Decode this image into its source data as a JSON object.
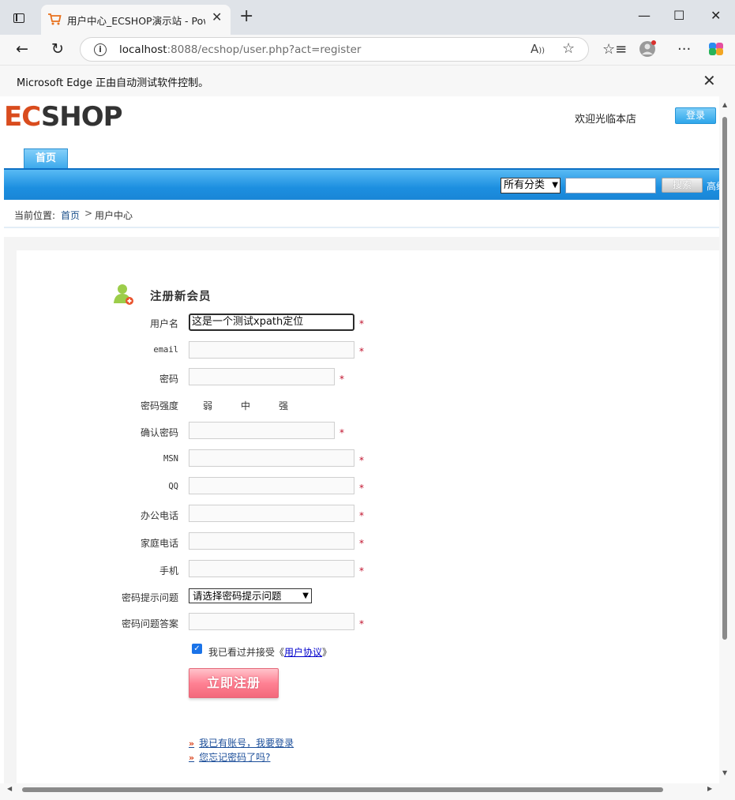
{
  "browser": {
    "tab_title": "用户中心_ECSHOP演示站 - Powered by ECShop",
    "tab_close": "✕",
    "new_tab": "+",
    "window": {
      "minimize": "—",
      "maximize": "☐",
      "close": "✕"
    },
    "url_host": "localhost",
    "url_rest": ":8088/ecshop/user.php?act=register",
    "read_aloud": "Ȃ",
    "infobar_message": "Microsoft Edge 正由自动测试软件控制。",
    "infobar_close": "✕"
  },
  "site": {
    "logo_ec": "EC",
    "logo_shop": "SHOP",
    "welcome": "欢迎光临本店",
    "login_button": "登录",
    "nav_home": "首页",
    "search": {
      "category_selected": "所有分类",
      "keyword": "",
      "button": "搜索",
      "advanced": "高级搜索"
    },
    "breadcrumb": {
      "prefix": "当前位置:",
      "home": "首页",
      "separator": ">",
      "current": "用户中心"
    }
  },
  "register": {
    "title": "注册新会员",
    "fields": {
      "username": {
        "label": "用户名",
        "value": "这是一个测试xpath定位",
        "required": "*"
      },
      "email": {
        "label": "email",
        "value": "",
        "required": "*"
      },
      "password": {
        "label": "密码",
        "value": "",
        "required": "*"
      },
      "strength": {
        "label": "密码强度",
        "weak": "弱",
        "medium": "中",
        "strong": "强"
      },
      "confirm_password": {
        "label": "确认密码",
        "value": "",
        "required": "*"
      },
      "msn": {
        "label": "MSN",
        "value": "",
        "required": "*"
      },
      "qq": {
        "label": "QQ",
        "value": "",
        "required": "*"
      },
      "office_phone": {
        "label": "办公电话",
        "value": "",
        "required": "*"
      },
      "home_phone": {
        "label": "家庭电话",
        "value": "",
        "required": "*"
      },
      "mobile": {
        "label": "手机",
        "value": "",
        "required": "*"
      },
      "question": {
        "label": "密码提示问题",
        "selected": "请选择密码提示问题"
      },
      "answer": {
        "label": "密码问题答案",
        "value": "",
        "required": "*"
      }
    },
    "agree_prefix": "我已看过并接受《",
    "agree_link": "用户协议",
    "agree_suffix": "》",
    "agree_checked": true,
    "submit": "立即注册",
    "link_login": "我已有账号，我要登录",
    "link_forgot": "您忘记密码了吗?"
  }
}
